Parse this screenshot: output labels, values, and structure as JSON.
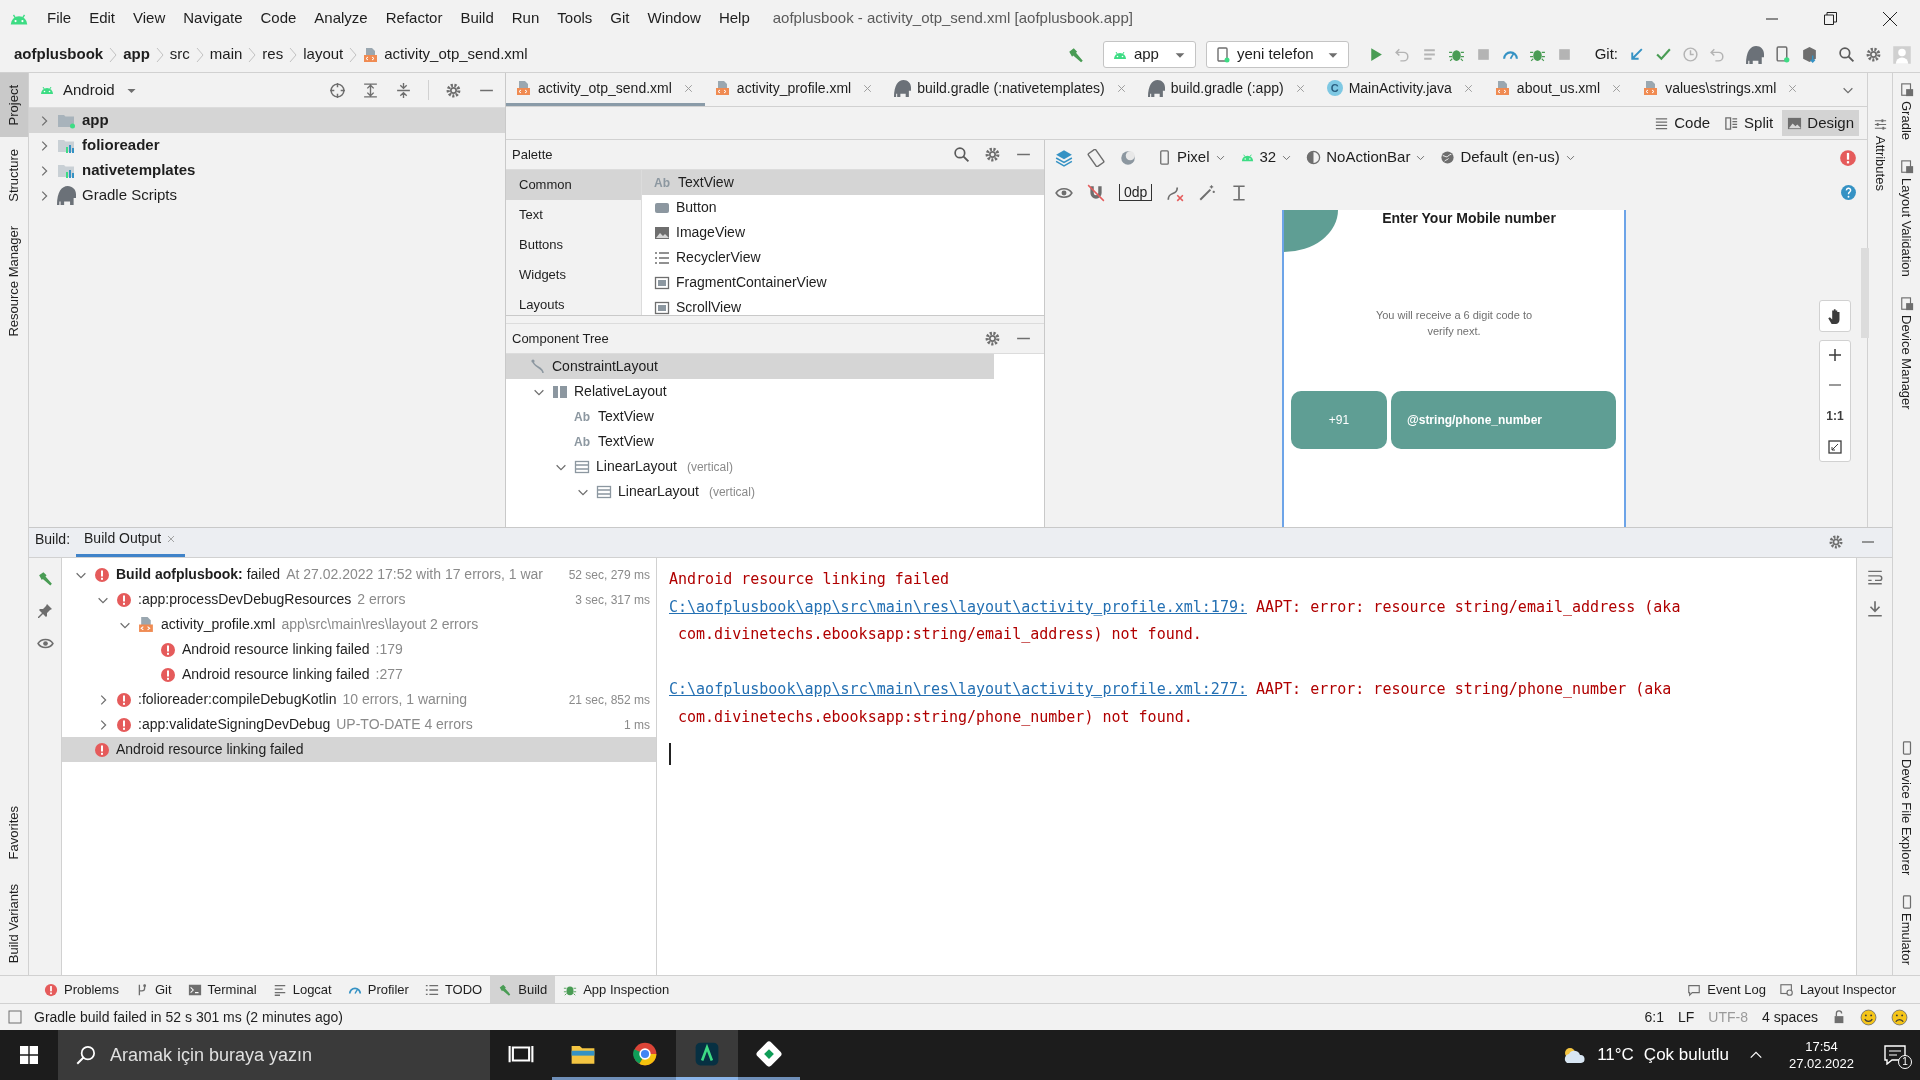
{
  "window": {
    "title": "aofplusbook - activity_otp_send.xml [aofplusbook.app]"
  },
  "menu": [
    "File",
    "Edit",
    "View",
    "Navigate",
    "Code",
    "Analyze",
    "Refactor",
    "Build",
    "Run",
    "Tools",
    "Git",
    "Window",
    "Help"
  ],
  "breadcrumbs": [
    {
      "label": "aofplusbook",
      "bold": true
    },
    {
      "label": "app",
      "bold": true
    },
    {
      "label": "src",
      "bold": false
    },
    {
      "label": "main",
      "bold": false
    },
    {
      "label": "res",
      "bold": false
    },
    {
      "label": "layout",
      "bold": false
    },
    {
      "label": "activity_otp_send.xml",
      "bold": false,
      "kind": "xml"
    }
  ],
  "toolbar": {
    "run_config": "app",
    "device": "yeni telefon",
    "git_label": "Git:"
  },
  "left_tabs": {
    "top": [
      {
        "label": "Project",
        "selected": true
      },
      {
        "label": "Structure",
        "selected": false
      },
      {
        "label": "Resource Manager",
        "selected": false
      }
    ],
    "bottom": [
      {
        "label": "Favorites",
        "selected": false
      },
      {
        "label": "Build Variants",
        "selected": false
      }
    ]
  },
  "right_tabs": {
    "top": [
      "Gradle",
      "Layout Validation",
      "Device Manager"
    ],
    "bottom": [
      "Device File Explorer",
      "Emulator"
    ]
  },
  "project_panel": {
    "view": "Android",
    "items": [
      {
        "label": "app",
        "kind": "app",
        "selected": true
      },
      {
        "label": "folioreader",
        "kind": "module",
        "selected": false
      },
      {
        "label": "nativetemplates",
        "kind": "module",
        "selected": false
      },
      {
        "label": "Gradle Scripts",
        "kind": "gradle",
        "selected": false
      }
    ]
  },
  "editor_tabs": [
    {
      "label": "activity_otp_send.xml",
      "kind": "xml",
      "selected": true
    },
    {
      "label": "activity_profile.xml",
      "kind": "xml",
      "selected": false
    },
    {
      "label": "build.gradle (:nativetemplates)",
      "kind": "gradle",
      "selected": false
    },
    {
      "label": "build.gradle (:app)",
      "kind": "gradle",
      "selected": false
    },
    {
      "label": "MainActivity.java",
      "kind": "class",
      "glyph": "C",
      "selected": false
    },
    {
      "label": "about_us.xml",
      "kind": "xml",
      "selected": false
    },
    {
      "label": "values\\strings.xml",
      "kind": "xml",
      "selected": false
    }
  ],
  "view_modes": [
    {
      "label": "Code",
      "kind": "code",
      "selected": false
    },
    {
      "label": "Split",
      "kind": "split",
      "selected": false
    },
    {
      "label": "Design",
      "kind": "design",
      "selected": true
    }
  ],
  "attributes_tab": "Attributes",
  "palette": {
    "title": "Palette",
    "categories": [
      {
        "label": "Common",
        "selected": true
      },
      {
        "label": "Text",
        "selected": false
      },
      {
        "label": "Buttons",
        "selected": false
      },
      {
        "label": "Widgets",
        "selected": false
      },
      {
        "label": "Layouts",
        "selected": false
      }
    ],
    "items": [
      {
        "label": "TextView",
        "kind": "text",
        "glyph": "Ab",
        "selected": true
      },
      {
        "label": "Button",
        "kind": "button",
        "selected": false
      },
      {
        "label": "ImageView",
        "kind": "image",
        "selected": false
      },
      {
        "label": "RecyclerView",
        "kind": "list",
        "selected": false
      },
      {
        "label": "FragmentContainerView",
        "kind": "fragment",
        "selected": false
      },
      {
        "label": "ScrollView",
        "kind": "fragment",
        "selected": false
      }
    ]
  },
  "design_toolbar": {
    "device": "Pixel",
    "api": "32",
    "theme": "NoActionBar",
    "locale": "Default (en-us)",
    "margin": "0dp"
  },
  "component_tree": {
    "title": "Component Tree",
    "nodes": [
      {
        "label": "ConstraintLayout",
        "kind": "constraint",
        "selected": true,
        "children": [
          {
            "label": "RelativeLayout",
            "kind": "relative",
            "expanded": true,
            "selected": false,
            "children": [
              {
                "label": "TextView",
                "kind": "text",
                "glyph": "Ab",
                "selected": false
              },
              {
                "label": "TextView",
                "kind": "text",
                "glyph": "Ab",
                "selected": false
              },
              {
                "label": "LinearLayout",
                "kind": "linear",
                "note": "(vertical)",
                "expanded": true,
                "selected": false,
                "children": [
                  {
                    "label": "LinearLayout",
                    "kind": "linear",
                    "note": "(vertical)",
                    "expanded": true,
                    "selected": false
                  }
                ]
              }
            ]
          }
        ]
      }
    ]
  },
  "preview": {
    "heading": "Enter Your Mobile number",
    "subtitle": "You will receive a 6 digit code to verify next.",
    "code": "+91",
    "phone": "@string/phone_number"
  },
  "zoom_reset": "1:1",
  "build": {
    "label": "Build:",
    "tabs": [
      {
        "label": "Build Output",
        "selected": true
      }
    ],
    "tree": [
      {
        "label": "**Build aofplusbook:** failed",
        "detail": "At 27.02.2022 17:52 with 17 errors, 1 war",
        "time": "52 sec, 279 ms",
        "kind": "error",
        "expanded": true,
        "selected": false,
        "children": [
          {
            "label": ":app:processDevDebugResources",
            "detail": "2 errors",
            "time": "3 sec, 317 ms",
            "kind": "error",
            "expanded": true,
            "selected": false,
            "children": [
              {
                "label": "activity_profile.xml",
                "detail": "app\\src\\main\\res\\layout 2 errors",
                "kind": "xml",
                "expanded": true,
                "selected": false,
                "children": [
                  {
                    "label": "Android resource linking failed",
                    "detail": ":179",
                    "kind": "error",
                    "selected": false
                  },
                  {
                    "label": "Android resource linking failed",
                    "detail": ":277",
                    "kind": "error",
                    "selected": false
                  }
                ]
              }
            ]
          },
          {
            "label": ":folioreader:compileDebugKotlin",
            "detail": "10 errors, 1 warning",
            "time": "21 sec, 852 ms",
            "kind": "error",
            "expanded": false,
            "selected": false
          },
          {
            "label": ":app:validateSigningDevDebug",
            "detail": "UP-TO-DATE 4 errors",
            "time": "1 ms",
            "kind": "error",
            "expanded": false,
            "selected": false
          }
        ]
      },
      {
        "label": "Android resource linking failed",
        "kind": "error",
        "selected": true
      }
    ],
    "console": {
      "header": "Android resource linking failed",
      "messages": [
        {
          "link": "C:\\aofplusbook\\app\\src\\main\\res\\layout\\activity_profile.xml:179:",
          "text": "AAPT: error: resource string/email_address (aka",
          "continuation": "com.divinetechs.ebooksapp:string/email_address) not found."
        },
        {
          "link": "C:\\aofplusbook\\app\\src\\main\\res\\layout\\activity_profile.xml:277:",
          "text": "AAPT: error: resource string/phone_number (aka",
          "continuation": "com.divinetechs.ebooksapp:string/phone_number) not found."
        }
      ]
    }
  },
  "tool_windows": [
    {
      "label": "Problems",
      "kind": "problems",
      "selected": false
    },
    {
      "label": "Git",
      "kind": "git",
      "selected": false
    },
    {
      "label": "Terminal",
      "kind": "terminal",
      "selected": false
    },
    {
      "label": "Logcat",
      "kind": "logcat",
      "selected": false
    },
    {
      "label": "Profiler",
      "kind": "profiler",
      "selected": false
    },
    {
      "label": "TODO",
      "kind": "todo",
      "selected": false
    },
    {
      "label": "Build",
      "kind": "build",
      "selected": true
    },
    {
      "label": "App Inspection",
      "kind": "inspection",
      "selected": false
    }
  ],
  "tool_windows_right": [
    {
      "label": "Event Log",
      "kind": "event"
    },
    {
      "label": "Layout Inspector",
      "kind": "inspector"
    }
  ],
  "status_bar": {
    "message": "Gradle build failed in 52 s 301 ms (2 minutes ago)",
    "items": [
      {
        "label": "6:1",
        "disabled": false
      },
      {
        "label": "LF",
        "disabled": false
      },
      {
        "label": "UTF-8",
        "disabled": true
      },
      {
        "label": "4 spaces",
        "disabled": false
      }
    ]
  },
  "taskbar": {
    "search_placeholder": "Aramak için buraya yazın",
    "apps": [
      {
        "kind": "task-view",
        "selected": false
      },
      {
        "kind": "folder",
        "selected": false
      },
      {
        "kind": "browser",
        "selected": false
      },
      {
        "kind": "studio",
        "selected": true
      },
      {
        "kind": "other",
        "selected": false
      }
    ],
    "temperature": "11°C",
    "weather": "Çok bulutlu",
    "time": "17:54",
    "date": "27.02.2022",
    "notifications": "1"
  }
}
